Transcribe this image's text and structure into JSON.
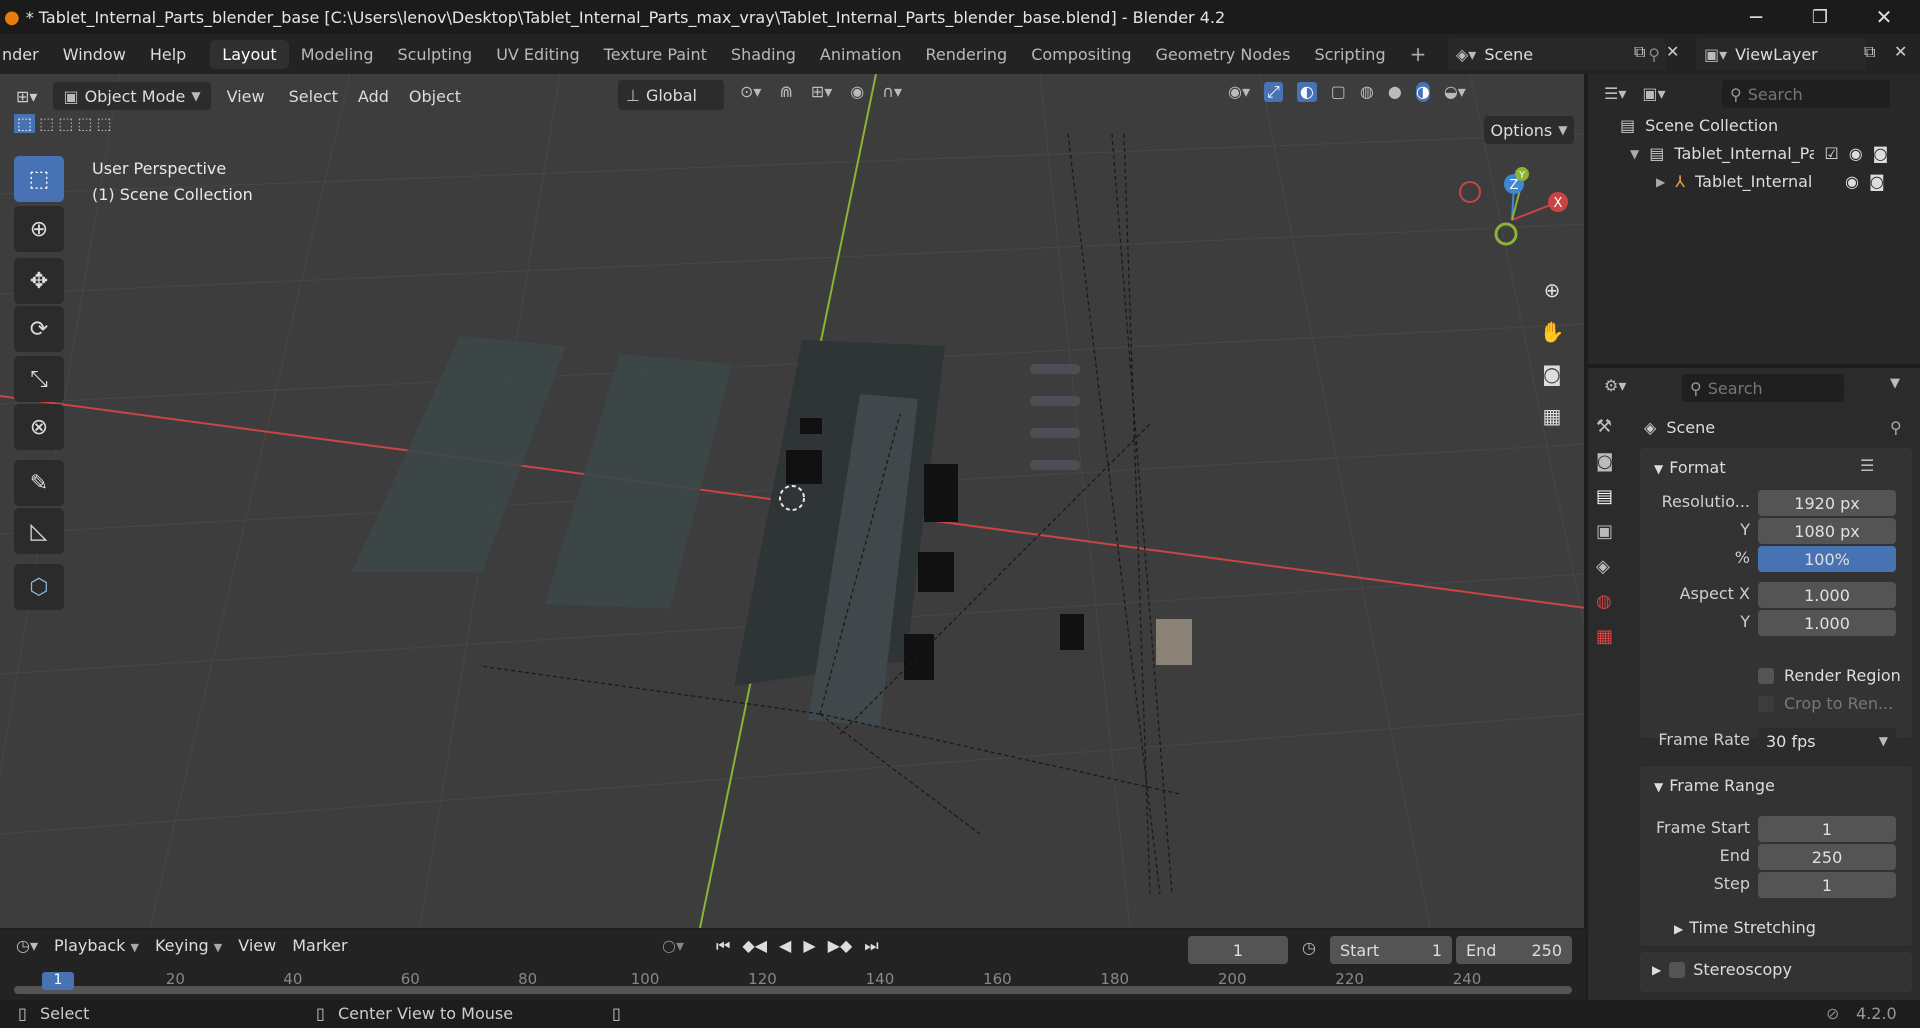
{
  "window": {
    "title": "* Tablet_Internal_Parts_blender_base [C:\\Users\\lenov\\Desktop\\Tablet_Internal_Parts_max_vray\\Tablet_Internal_Parts_blender_base.blend] - Blender 4.2",
    "minimize": "─",
    "maximize": "❐",
    "close": "✕"
  },
  "menu": {
    "items": [
      "nder",
      "Window",
      "Help"
    ],
    "workspaces": [
      "Layout",
      "Modeling",
      "Sculpting",
      "UV Editing",
      "Texture Paint",
      "Shading",
      "Animation",
      "Rendering",
      "Compositing",
      "Geometry Nodes",
      "Scripting"
    ],
    "active_workspace": "Layout",
    "add_tab": "+",
    "scene": "Scene",
    "view_layer": "ViewLayer"
  },
  "viewport": {
    "mode": "Object Mode",
    "menus": [
      "View",
      "Select",
      "Add",
      "Object"
    ],
    "orientation": "Global",
    "options": "Options",
    "overlay_line1": "User Perspective",
    "overlay_line2": "(1) Scene Collection",
    "gizmo": {
      "z": "Z",
      "y": "Y",
      "x": "X"
    }
  },
  "outliner": {
    "search_placeholder": "Search",
    "root": "Scene Collection",
    "items": [
      {
        "label": "Tablet_Internal_Pai"
      },
      {
        "label": "Tablet_Internal"
      }
    ]
  },
  "properties": {
    "search_placeholder": "Search",
    "context": "Scene",
    "format": {
      "title": "Format",
      "resolution_x_label": "Resolutio...",
      "resolution_x": "1920 px",
      "resolution_y_label": "Y",
      "resolution_y": "1080 px",
      "percent_label": "%",
      "percent": "100%",
      "percent_fraction": 1.0,
      "aspect_x_label": "Aspect X",
      "aspect_x": "1.000",
      "aspect_y_label": "Y",
      "aspect_y": "1.000",
      "render_region": "Render Region",
      "crop": "Crop to Ren...",
      "frame_rate_label": "Frame Rate",
      "frame_rate": "30 fps"
    },
    "frame_range": {
      "title": "Frame Range",
      "start_label": "Frame Start",
      "start": "1",
      "end_label": "End",
      "end": "250",
      "step_label": "Step",
      "step": "1"
    },
    "time_stretching": "Time Stretching",
    "stereoscopy": "Stereoscopy"
  },
  "timeline": {
    "menus": [
      "Playback",
      "Keying",
      "View",
      "Marker"
    ],
    "current_frame": "1",
    "start_label": "Start",
    "start": "1",
    "end_label": "End",
    "end": "250",
    "ticks": [
      "1",
      "20",
      "40",
      "60",
      "80",
      "100",
      "120",
      "140",
      "160",
      "180",
      "200",
      "220",
      "240"
    ]
  },
  "status": {
    "select": "Select",
    "center": "Center View to Mouse",
    "version": "4.2.0"
  },
  "colors": {
    "accent": "#4772b3",
    "x_axis": "#c94545",
    "y_axis": "#8bb335",
    "z_axis": "#3e86d6"
  }
}
